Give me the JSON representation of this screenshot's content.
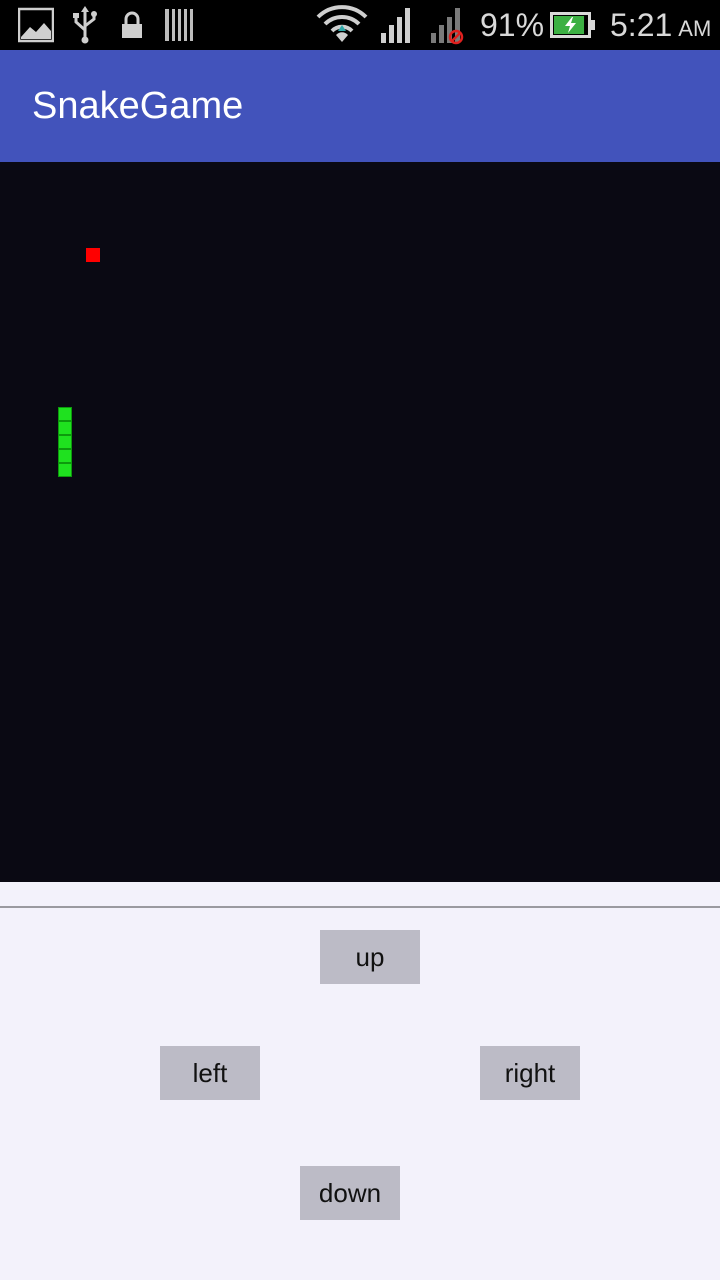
{
  "status_bar": {
    "battery_percent": "91%",
    "time": "5:21",
    "ampm": "AM",
    "icons": [
      "image-icon",
      "usb-icon",
      "lock-icon",
      "sd-card-icon",
      "wifi-icon",
      "signal-icon",
      "signal-no-service-icon",
      "battery-charging-icon"
    ],
    "battery_level": 0.91,
    "battery_color": "#3cb043"
  },
  "app_bar": {
    "title": "SnakeGame",
    "color": "#4253bb"
  },
  "game": {
    "background": "#0a0913",
    "food_color": "#ff0000",
    "snake_color": "#1fe11f",
    "snake_length": 5
  },
  "controls": {
    "up": "up",
    "left": "left",
    "right": "right",
    "down": "down"
  }
}
